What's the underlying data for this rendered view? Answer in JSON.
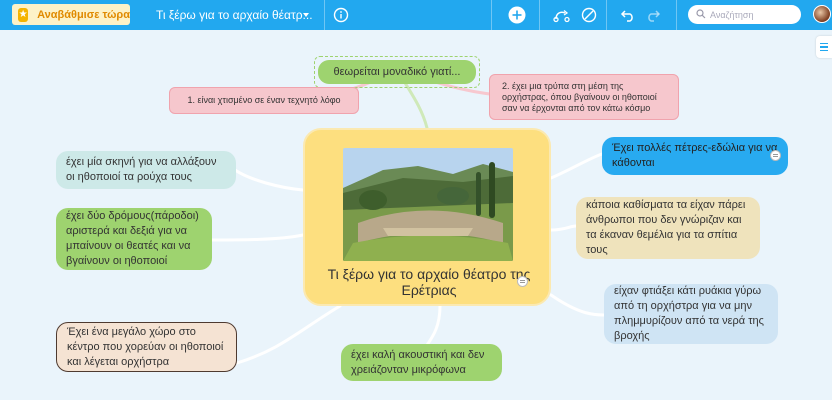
{
  "toolbar": {
    "upgrade_label": "Αναβάθμισε τώρα",
    "document_title": "Τι ξέρω για το αρχαίο θέατρ...",
    "search_placeholder": "Αναζήτηση",
    "accent_color": "#22a8ef",
    "icons": [
      "star-icon",
      "info-icon",
      "add-icon",
      "style-icon",
      "cancel-icon",
      "undo-icon",
      "redo-icon",
      "search-icon",
      "avatar"
    ]
  },
  "mindmap": {
    "central": {
      "title": "Τι ξέρω για το αρχαίο θέατρο της Ερέτριας",
      "color": "#fddf7f"
    },
    "nodes": {
      "top_center": "θεωρείται  μοναδικό γιατί...",
      "top_left_pink": "1. είναι χτισμένο σε έναν τεχνητό λόφο",
      "top_right_pink": "2. έχει μια τρύπα στη μέση της ορχήστρας,  όπου βγαίνουν οι ηθοποιοί σαν να  έρχονται από τον κάτω κόσμο",
      "left_1": "έχει μία σκηνή για να αλλάξουν οι ηθοποιοί τα ρούχα τους",
      "left_2": "έχει δύο δρόμους(πάροδοι) αριστερά και δεξιά για να μπαίνουν οι θεατές και να βγαίνουν οι ηθοποιοί",
      "left_3": "Έχει ένα μεγάλο χώρο στο κέντρο που χορεύαν οι ηθοποιοί και λέγεται ορχήστρα",
      "bottom_center": "έχει καλή ακουστική και δεν χρειάζονταν μικρόφωνα",
      "right_1": "Έχει πολλές πέτρες-εδώλια για να κάθονται",
      "right_2": "κάποια καθίσματα τα είχαν πάρει άνθρωποι που δεν  γνώριζαν και τα έκαναν θεμέλια  για τα σπίτια τους",
      "right_3": "είχαν φτιάξει κάτι ρυάκια γύρω από τη ορχήστρα για να μην πλημμυρίζουν από τα νερά της βροχής"
    }
  }
}
